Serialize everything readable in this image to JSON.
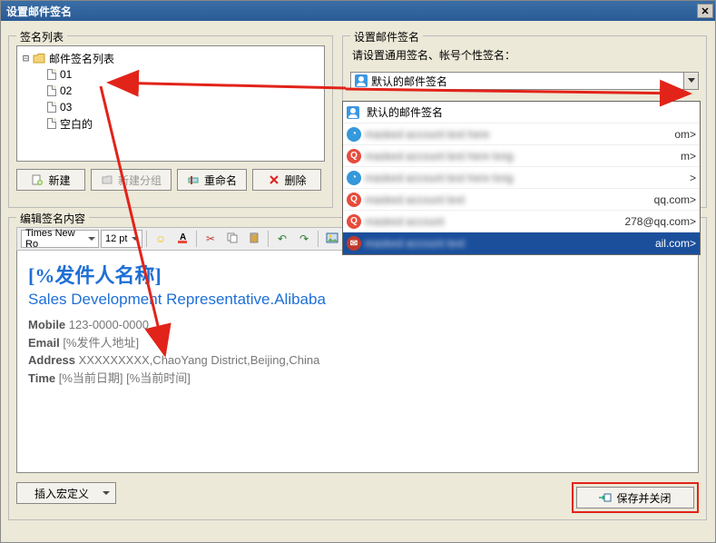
{
  "title": "设置邮件签名",
  "list_panel": {
    "legend": "签名列表",
    "root": "邮件签名列表",
    "items": [
      "01",
      "02",
      "03",
      "空白的"
    ],
    "buttons": {
      "new": "新建",
      "new_group": "新建分组",
      "rename": "重命名",
      "delete": "删除"
    }
  },
  "set_panel": {
    "legend": "设置邮件签名",
    "instruction": "请设置通用签名、帐号个性签名：",
    "combo_value": "默认的邮件签名",
    "dropdown": [
      {
        "icon": "avatar",
        "label": "默认的邮件签名",
        "tail": ""
      },
      {
        "icon": "b",
        "label_masked": true,
        "tail": "om>"
      },
      {
        "icon": "q",
        "label_masked": true,
        "tail": "m>"
      },
      {
        "icon": "b",
        "label_masked": true,
        "tail": ">"
      },
      {
        "icon": "q",
        "label_masked": true,
        "tail": "qq.com>"
      },
      {
        "icon": "q",
        "label_masked": true,
        "tail": "278@qq.com>"
      },
      {
        "icon": "g",
        "label_masked": true,
        "tail": "ail.com>",
        "highlight": true
      }
    ]
  },
  "edit_panel": {
    "legend": "编辑签名内容",
    "font": "Times New Ro",
    "size": "12 pt",
    "signature": {
      "name": "[%发件人名称]",
      "title": "Sales Development Representative.Alibaba",
      "mobile_label": "Mobile",
      "mobile": "123-0000-0000",
      "email_label": "Email",
      "email": "[%发件人地址]",
      "address_label": "Address",
      "address": "XXXXXXXXX,ChaoYang District,Beijing,China",
      "time_label": "Time",
      "time": "[%当前日期] [%当前时间]"
    },
    "insert_macro": "插入宏定义",
    "save_close": "保存并关闭"
  }
}
